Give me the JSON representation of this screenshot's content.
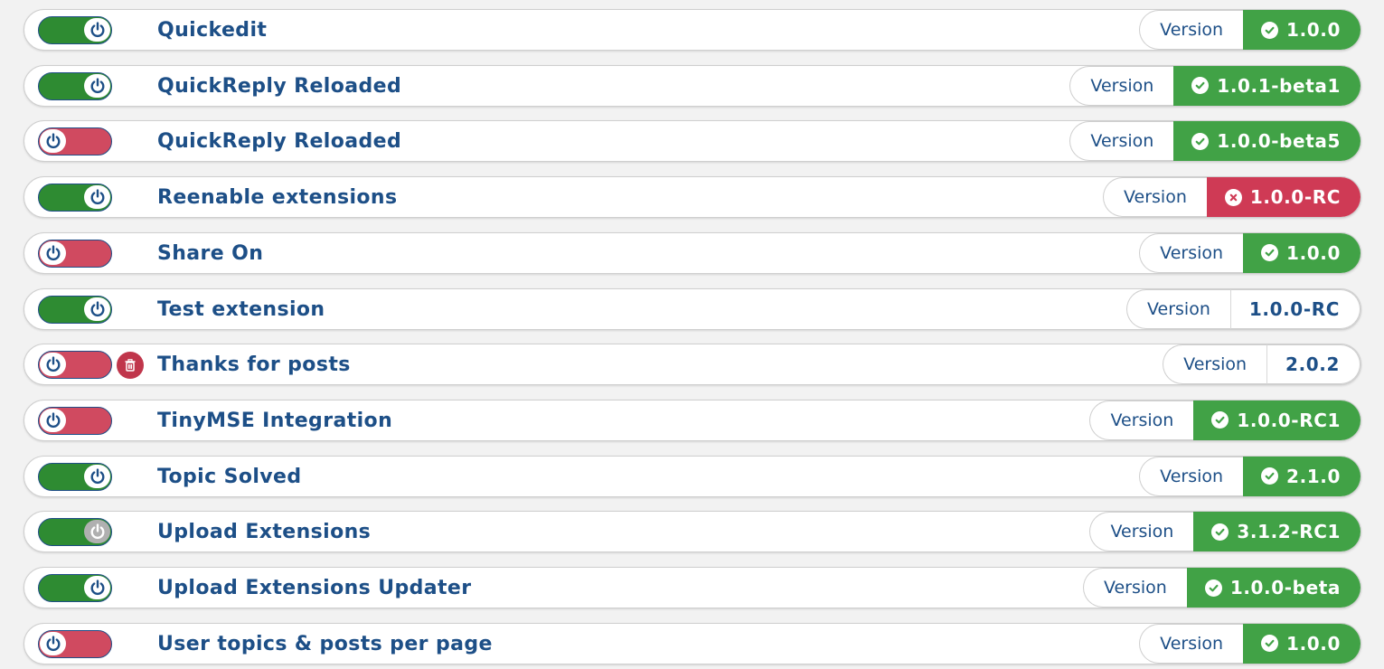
{
  "version_label": "Version",
  "colors": {
    "toggle_on": "#2e8b32",
    "toggle_off": "#d04a60",
    "version_ok": "#41a246",
    "version_bad": "#cf3a55",
    "name_text": "#1d4f87"
  },
  "extensions": [
    {
      "name": "Quickedit",
      "enabled": true,
      "version": "1.0.0",
      "version_status": "ok"
    },
    {
      "name": "QuickReply Reloaded",
      "enabled": true,
      "version": "1.0.1-beta1",
      "version_status": "ok"
    },
    {
      "name": "QuickReply Reloaded",
      "enabled": false,
      "version": "1.0.0-beta5",
      "version_status": "ok"
    },
    {
      "name": "Reenable extensions",
      "enabled": true,
      "version": "1.0.0-RC",
      "version_status": "bad"
    },
    {
      "name": "Share On",
      "enabled": false,
      "version": "1.0.0",
      "version_status": "ok"
    },
    {
      "name": "Test extension",
      "enabled": true,
      "version": "1.0.0-RC",
      "version_status": "plain"
    },
    {
      "name": "Thanks for posts",
      "enabled": false,
      "deletable": true,
      "version": "2.0.2",
      "version_status": "plain"
    },
    {
      "name": "TinyMSE Integration",
      "enabled": false,
      "version": "1.0.0-RC1",
      "version_status": "ok"
    },
    {
      "name": "Topic Solved",
      "enabled": true,
      "version": "2.1.0",
      "version_status": "ok"
    },
    {
      "name": "Upload Extensions",
      "enabled": true,
      "locked": true,
      "version": "3.1.2-RC1",
      "version_status": "ok"
    },
    {
      "name": "Upload Extensions Updater",
      "enabled": true,
      "version": "1.0.0-beta",
      "version_status": "ok"
    },
    {
      "name": "User topics & posts per page",
      "enabled": false,
      "version": "1.0.0",
      "version_status": "ok"
    }
  ]
}
